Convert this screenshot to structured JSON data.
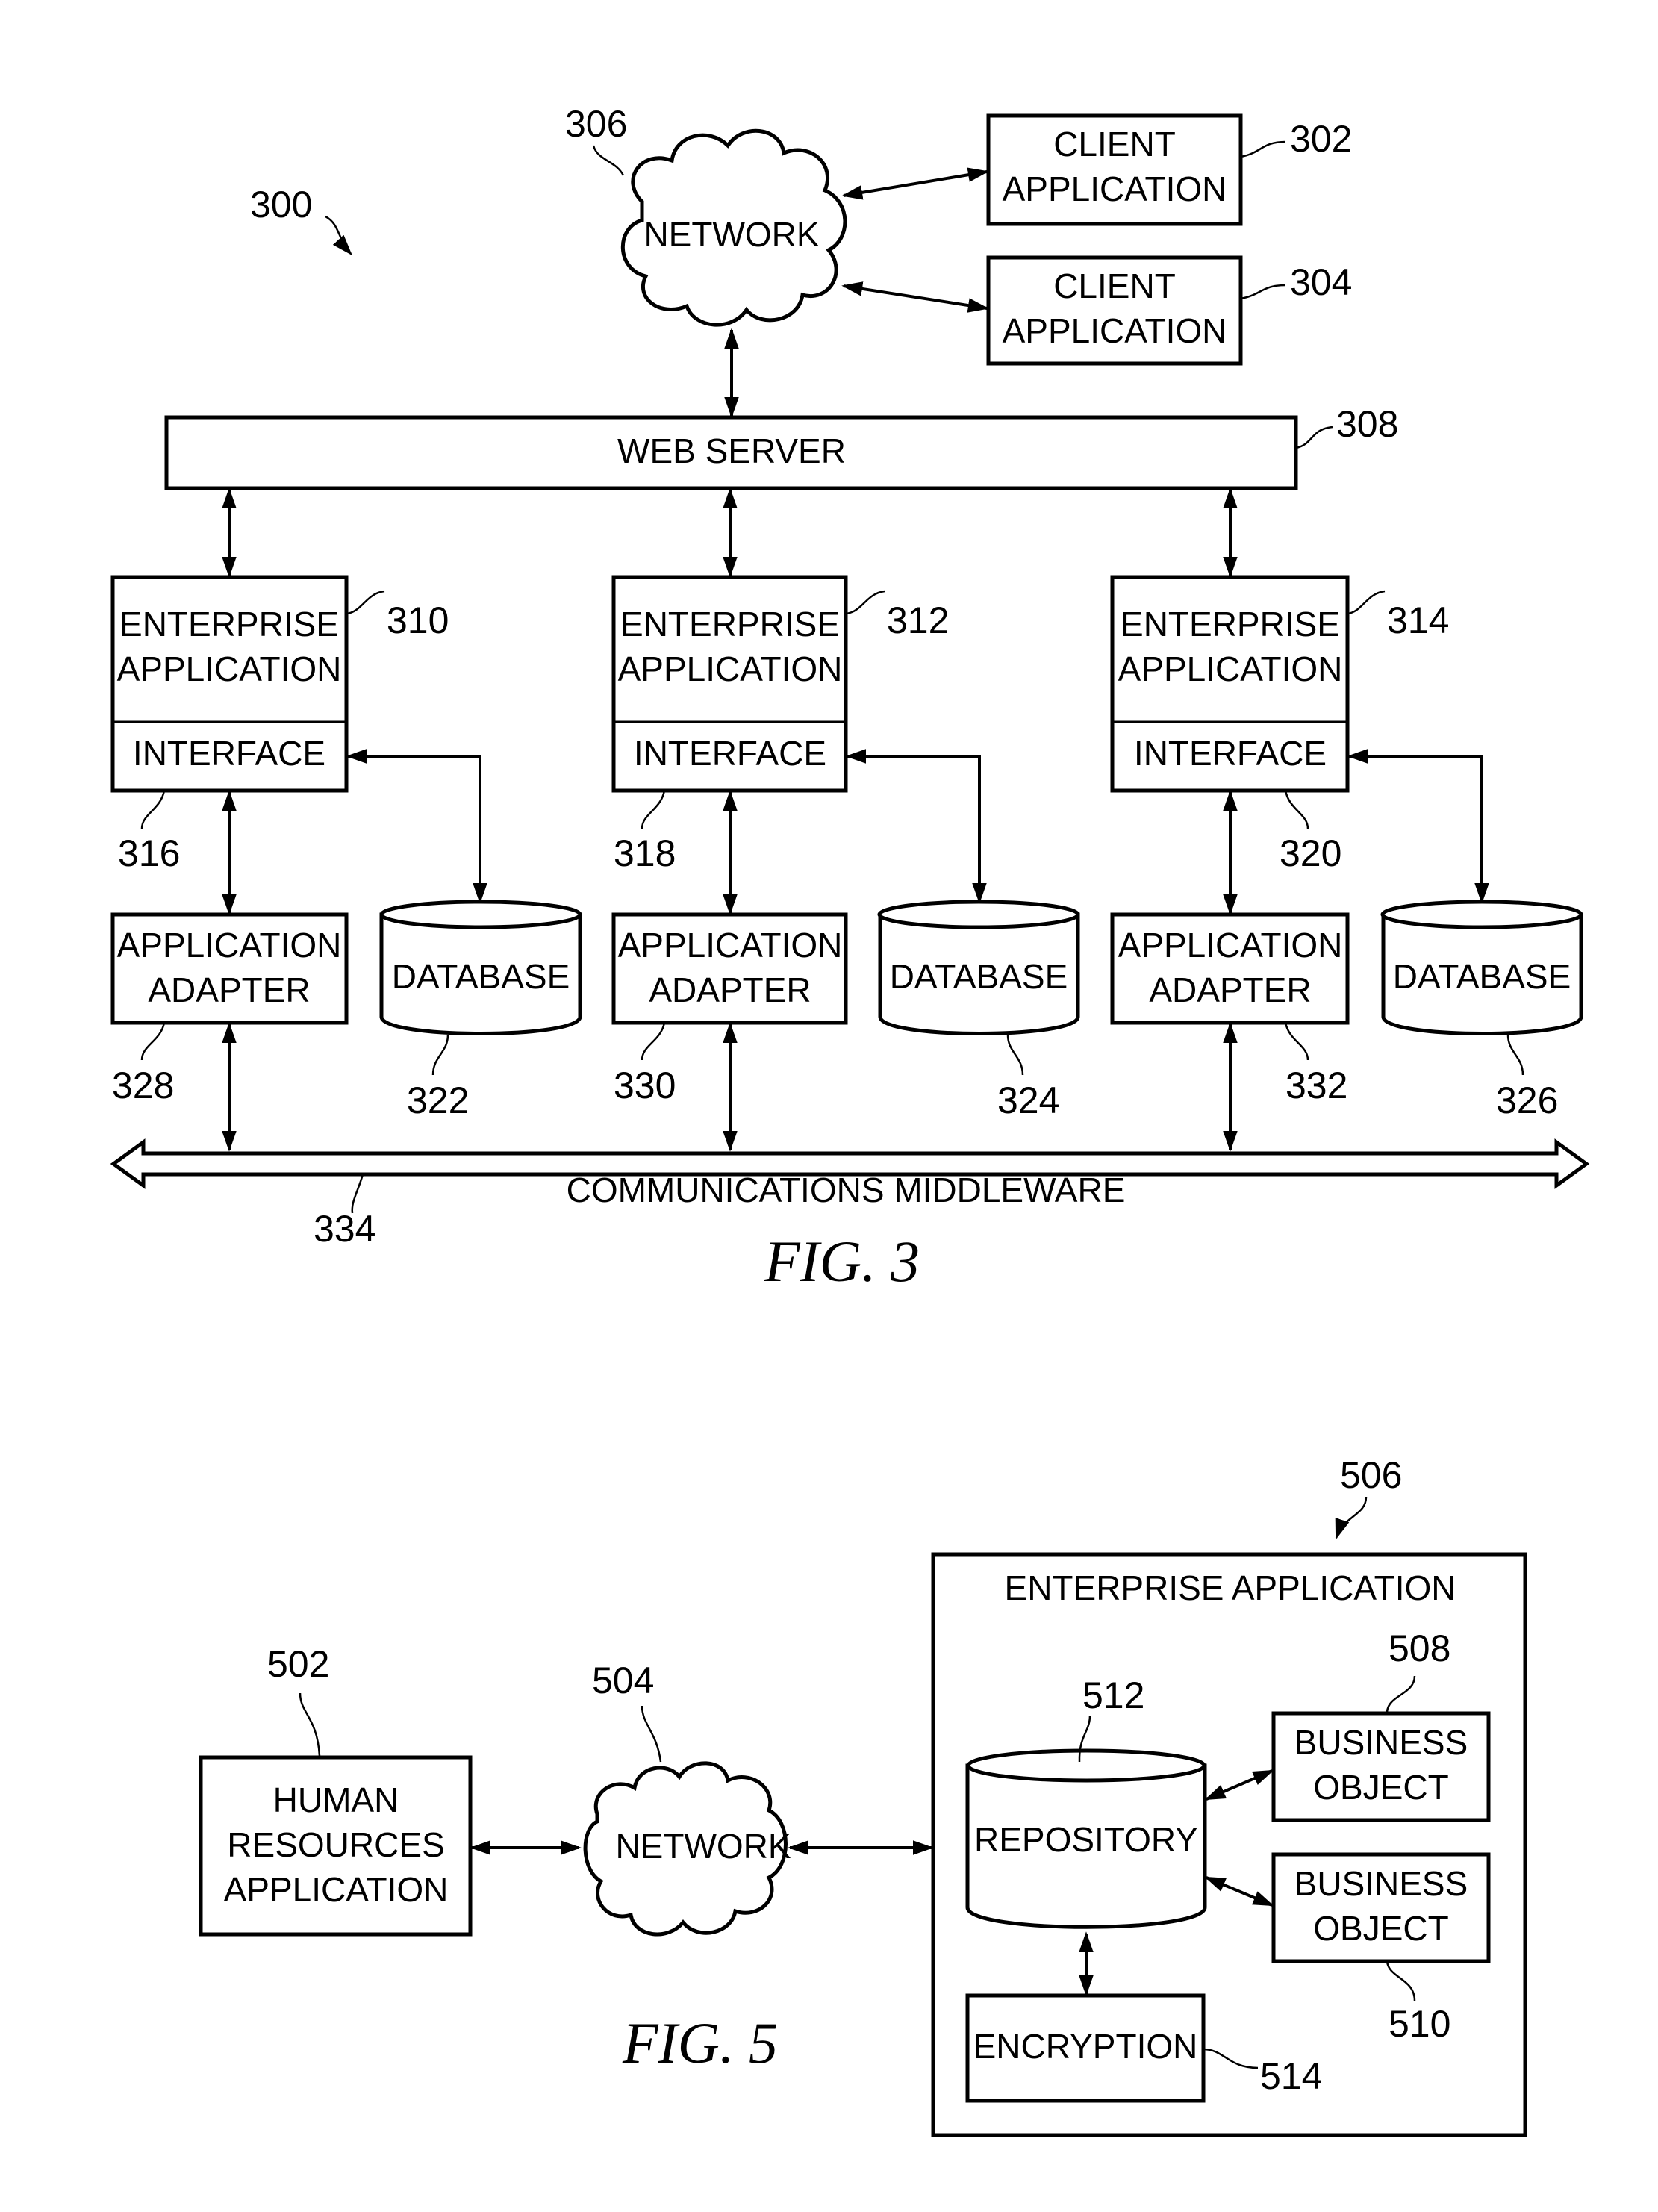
{
  "fig3": {
    "caption": "FIG. 3",
    "system_ref": "300",
    "network": {
      "label": "NETWORK",
      "ref": "306"
    },
    "clients": [
      {
        "line1": "CLIENT",
        "line2": "APPLICATION",
        "ref": "302"
      },
      {
        "line1": "CLIENT",
        "line2": "APPLICATION",
        "ref": "304"
      }
    ],
    "web_server": {
      "label": "WEB SERVER",
      "ref": "308"
    },
    "columns": [
      {
        "enterprise": {
          "line1": "ENTERPRISE",
          "line2": "APPLICATION",
          "ref": "310"
        },
        "interface": {
          "label": "INTERFACE",
          "ref": "316"
        },
        "adapter": {
          "line1": "APPLICATION",
          "line2": "ADAPTER",
          "ref": "328"
        },
        "database": {
          "label": "DATABASE",
          "ref": "322"
        }
      },
      {
        "enterprise": {
          "line1": "ENTERPRISE",
          "line2": "APPLICATION",
          "ref": "312"
        },
        "interface": {
          "label": "INTERFACE",
          "ref": "318"
        },
        "adapter": {
          "line1": "APPLICATION",
          "line2": "ADAPTER",
          "ref": "330"
        },
        "database": {
          "label": "DATABASE",
          "ref": "324"
        }
      },
      {
        "enterprise": {
          "line1": "ENTERPRISE",
          "line2": "APPLICATION",
          "ref": "314"
        },
        "interface": {
          "label": "INTERFACE",
          "ref": "320"
        },
        "adapter": {
          "line1": "APPLICATION",
          "line2": "ADAPTER",
          "ref": "332"
        },
        "database": {
          "label": "DATABASE",
          "ref": "326"
        }
      }
    ],
    "middleware": {
      "label": "COMMUNICATIONS MIDDLEWARE",
      "ref": "334"
    }
  },
  "fig5": {
    "caption": "FIG. 5",
    "hr_app": {
      "line1": "HUMAN",
      "line2": "RESOURCES",
      "line3": "APPLICATION",
      "ref": "502"
    },
    "network": {
      "label": "NETWORK",
      "ref": "504"
    },
    "enterprise": {
      "label": "ENTERPRISE APPLICATION",
      "ref": "506"
    },
    "business_objects": [
      {
        "line1": "BUSINESS",
        "line2": "OBJECT",
        "ref": "508"
      },
      {
        "line1": "BUSINESS",
        "line2": "OBJECT",
        "ref": "510"
      }
    ],
    "repository": {
      "label": "REPOSITORY",
      "ref": "512"
    },
    "encryption": {
      "label": "ENCRYPTION",
      "ref": "514"
    }
  }
}
